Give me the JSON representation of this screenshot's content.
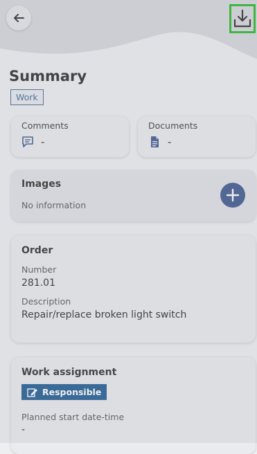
{
  "header": {
    "back_icon": "arrow-left-icon",
    "download_icon": "download-icon"
  },
  "page": {
    "title": "Summary",
    "category_badge": "Work"
  },
  "comments": {
    "label": "Comments",
    "icon": "comment-icon",
    "value": "-"
  },
  "documents": {
    "label": "Documents",
    "icon": "document-icon",
    "value": "-"
  },
  "images": {
    "title": "Images",
    "empty_text": "No information",
    "add_icon": "plus-icon"
  },
  "order": {
    "title": "Order",
    "number_label": "Number",
    "number_value": "281.01",
    "description_label": "Description",
    "description_value": "Repair/replace broken light switch"
  },
  "work_assignment": {
    "title": "Work assignment",
    "role_badge": "Responsible",
    "role_icon": "edit-icon",
    "planned_start_label": "Planned start date-time",
    "planned_start_value": "-"
  },
  "colors": {
    "accent": "#3e578e",
    "badge_blue": "#1f5a92",
    "highlight": "#22bb22"
  }
}
